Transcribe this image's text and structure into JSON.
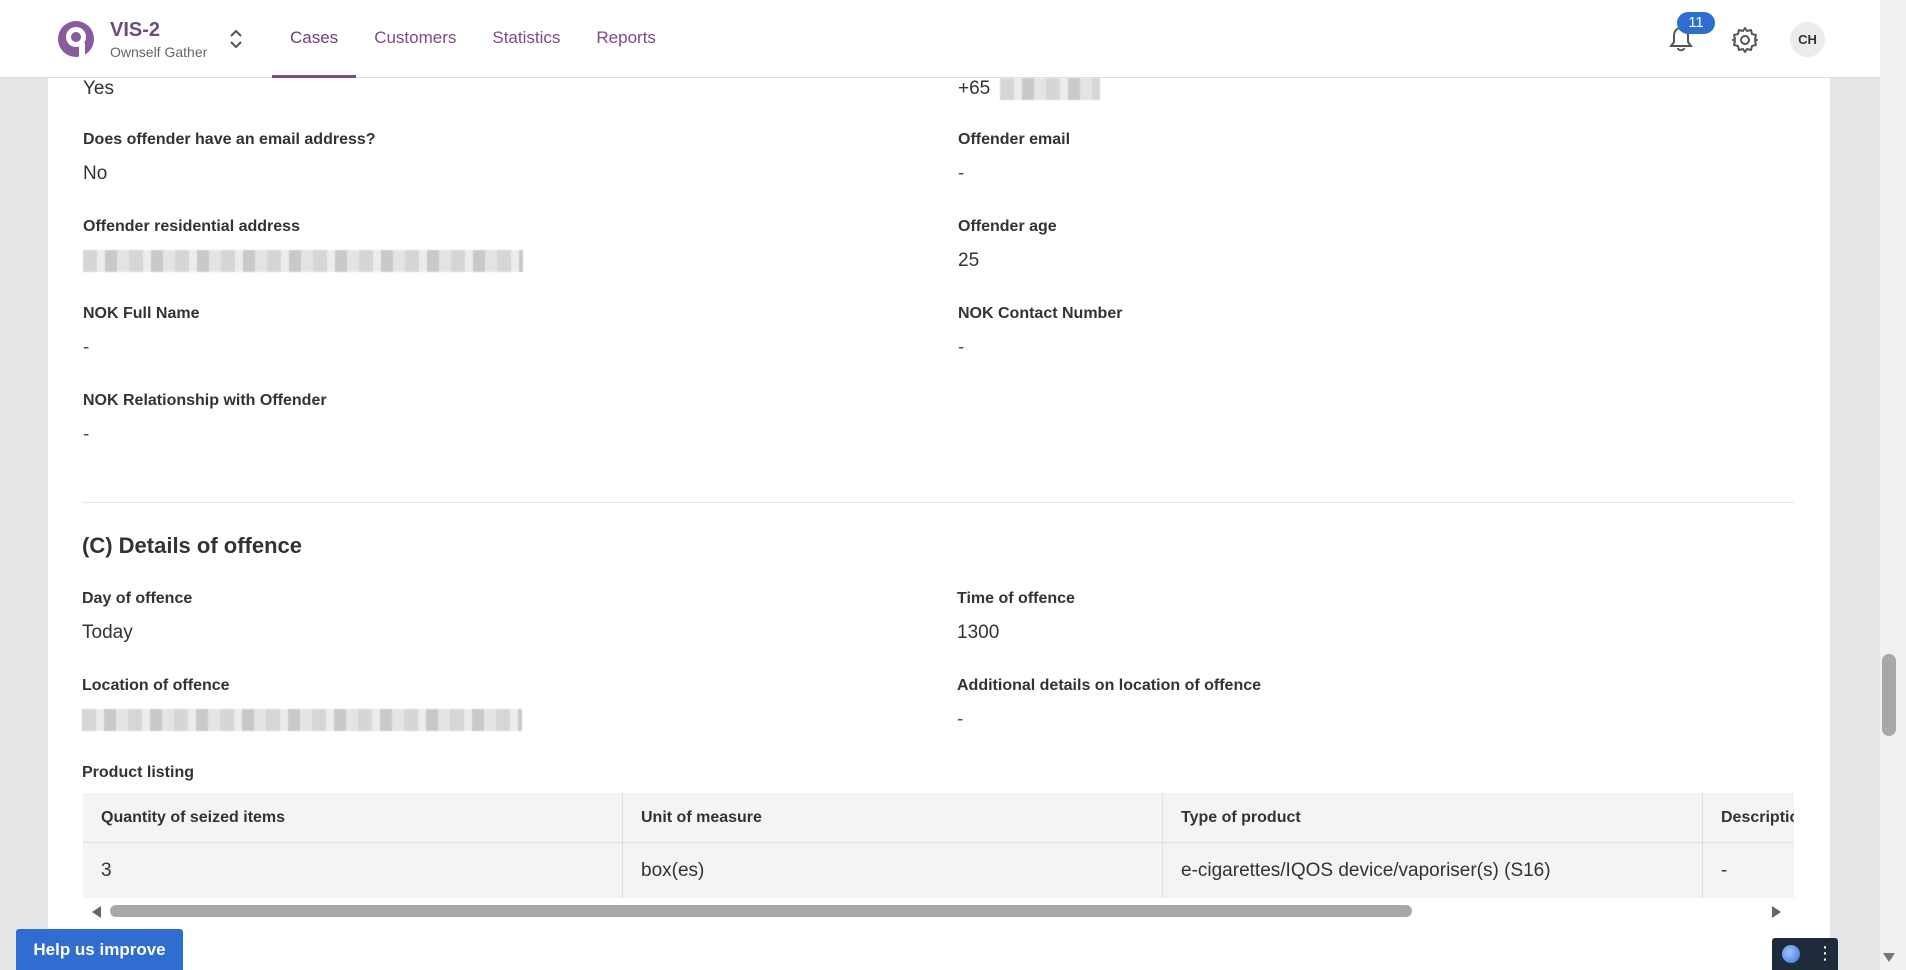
{
  "app": {
    "name": "VIS-2",
    "subtitle": "Ownself Gather"
  },
  "nav": {
    "items": [
      {
        "label": "Cases",
        "active": true
      },
      {
        "label": "Customers",
        "active": false
      },
      {
        "label": "Statistics",
        "active": false
      },
      {
        "label": "Reports",
        "active": false
      }
    ]
  },
  "header": {
    "notification_count": "11",
    "avatar_initials": "CH"
  },
  "offender": {
    "has_phone_value": "Yes",
    "phone_prefix": "+65",
    "has_email_label": "Does offender have an email address?",
    "has_email_value": "No",
    "email_label": "Offender email",
    "email_value": "-",
    "address_label": "Offender residential address",
    "age_label": "Offender age",
    "age_value": "25",
    "nok_name_label": "NOK Full Name",
    "nok_name_value": "-",
    "nok_contact_label": "NOK Contact Number",
    "nok_contact_value": "-",
    "nok_relationship_label": "NOK Relationship with Offender",
    "nok_relationship_value": "-"
  },
  "offence": {
    "section_title": "(C) Details of offence",
    "day_label": "Day of offence",
    "day_value": "Today",
    "time_label": "Time of offence",
    "time_value": "1300",
    "location_label": "Location of offence",
    "additional_location_label": "Additional details on location of offence",
    "additional_location_value": "-",
    "product_listing_label": "Product listing",
    "table": {
      "headers": [
        "Quantity of seized items",
        "Unit of measure",
        "Type of product",
        "Descriptio"
      ],
      "rows": [
        [
          "3",
          "box(es)",
          "e-cigarettes/IQOS device/vaporiser(s) (S16)",
          "-"
        ]
      ]
    }
  },
  "footer": {
    "help_label": "Help us improve",
    "widget_menu": "⋮"
  },
  "colors": {
    "brand_purple": "#7a4a8c",
    "accent_blue": "#2f6ed0"
  }
}
